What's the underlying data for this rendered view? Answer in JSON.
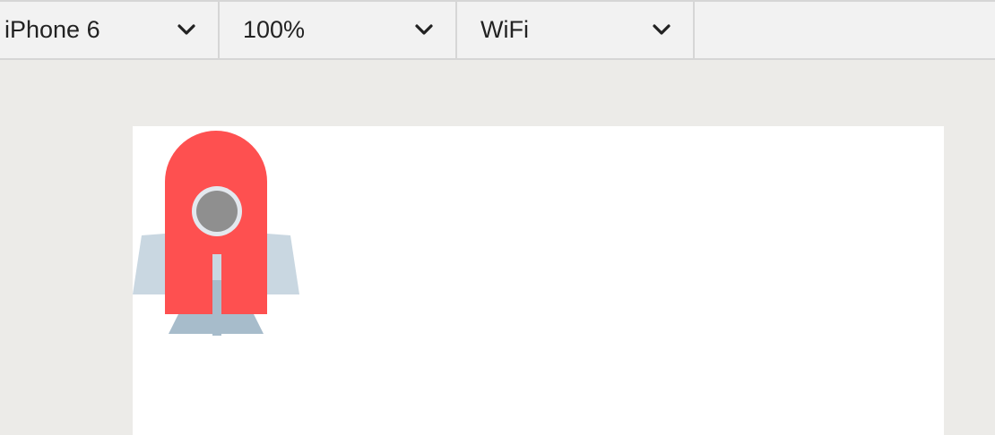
{
  "toolbar": {
    "device": {
      "label": "iPhone 6",
      "icon": "chevron-down-icon"
    },
    "zoom": {
      "label": "100%",
      "icon": "chevron-down-icon"
    },
    "network": {
      "label": "WiFi",
      "icon": "chevron-down-icon"
    }
  },
  "viewport": {
    "background": "#ffffff",
    "image": {
      "icon": "rocket-icon",
      "body_color": "#fe5050",
      "fin_color": "#c9d7e1"
    }
  }
}
